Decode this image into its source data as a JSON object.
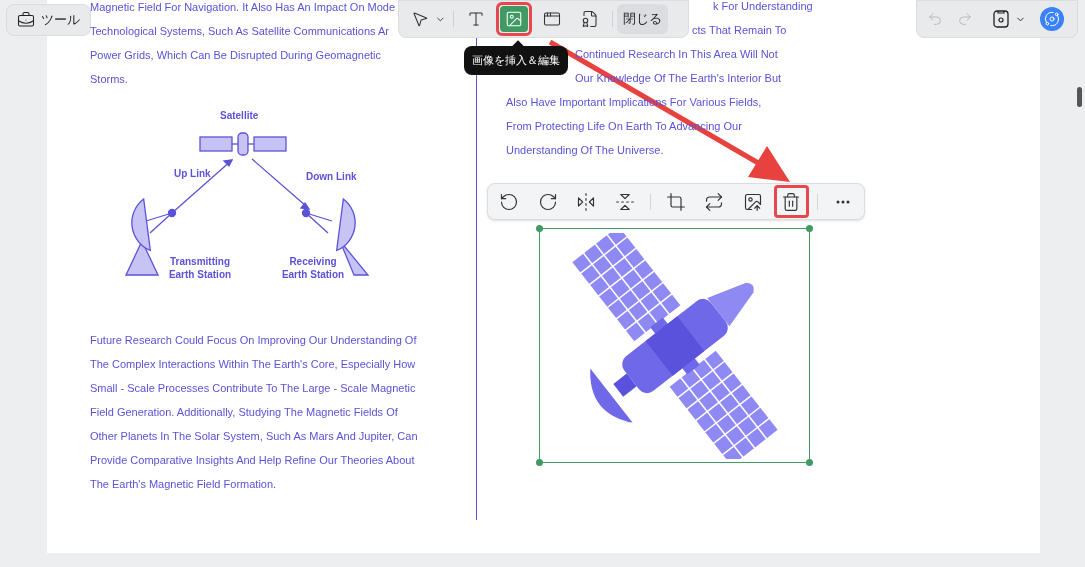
{
  "tools_button": {
    "label": "ツール"
  },
  "main_toolbar": {
    "tools": [
      {
        "kind": "select",
        "selected": false,
        "highlighted": false
      },
      {
        "kind": "text",
        "selected": false,
        "highlighted": false
      },
      {
        "kind": "image",
        "selected": true,
        "highlighted": true
      },
      {
        "kind": "link",
        "selected": false,
        "highlighted": false
      },
      {
        "kind": "stamp",
        "selected": false,
        "highlighted": false
      }
    ],
    "close_label": "閉じる"
  },
  "tooltip": "画像を挿入＆編集",
  "history": {
    "undo_disabled": true,
    "redo_disabled": true
  },
  "left_column": {
    "top_lines": [
      "Magnetic Field For Navigation. It Also Has An Impact On Mode",
      "Technological Systems, Such As Satellite Communications Ar",
      "Power Grids, Which Can Be Disrupted During Geomagnetic",
      "Storms."
    ],
    "diagram": {
      "satellite": "Satellite",
      "uplink": "Up Link",
      "downlink": "Down Link",
      "transmitter": "Transmitting Earth Station",
      "receiver": "Receiving Earth Station"
    },
    "bottom_lines": [
      "Future Research Could Focus On Improving Our Understanding Of",
      "The Complex Interactions Within The Earth's Core, Especially How",
      "Small - Scale Processes Contribute To The Large - Scale Magnetic",
      "Field Generation. Additionally, Studying The Magnetic Fields Of",
      "Other Planets In The Solar System, Such As Mars And Jupiter, Can",
      "Provide Comparative Insights And Help Refine Our Theories About",
      "The Earth's Magnetic Field Formation."
    ]
  },
  "right_column": {
    "lines": [
      "k For Understanding",
      "cts That Remain To",
      "Continued Research In This Area Will Not",
      "Our Knowledge Of The Earth's Interior But",
      "Also Have Important Implications For Various Fields,",
      "From Protecting Life On Earth To Advancing Our",
      "Understanding Of The Universe."
    ]
  },
  "image_toolbar": {
    "tools": [
      {
        "kind": "rotate-left",
        "highlighted": false
      },
      {
        "kind": "rotate-right",
        "highlighted": false
      },
      {
        "kind": "flip-horizontal",
        "highlighted": false
      },
      {
        "kind": "flip-vertical",
        "highlighted": false
      },
      {
        "kind": "crop",
        "highlighted": false
      },
      {
        "kind": "replace",
        "highlighted": false
      },
      {
        "kind": "extract",
        "highlighted": false
      },
      {
        "kind": "delete",
        "highlighted": true
      },
      {
        "kind": "more",
        "highlighted": false
      }
    ]
  }
}
